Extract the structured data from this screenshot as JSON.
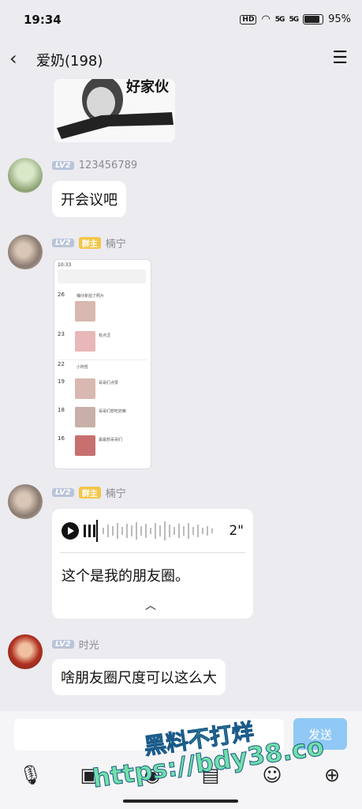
{
  "status": {
    "time": "19:34",
    "hd": "HD",
    "sig1": "5G",
    "sig2": "5G",
    "battery": "95%"
  },
  "header": {
    "title": "爱奶(198)"
  },
  "messages": [
    {
      "level": "LV2",
      "name": "123456789",
      "text": "开会议吧"
    },
    {
      "level": "LV2",
      "role": "群主",
      "name": "楠宁"
    },
    {
      "level": "LV2",
      "role": "群主",
      "name": "楠宁",
      "voice_duration": "2\"",
      "transcript": "这个是我的朋友圈。"
    },
    {
      "level": "LV2",
      "name": "时光",
      "text": "啥朋友圈尺度可以这么大"
    }
  ],
  "sticker": {
    "text": "好家伙"
  },
  "screenshot": {
    "top_time": "10:33",
    "entries": [
      {
        "day": "26",
        "text": "桶仔新拍了照片"
      },
      {
        "day": "23",
        "text": "有点涩"
      },
      {
        "day": "22",
        "text": "小阿哲"
      },
      {
        "day": "19",
        "text": "哥哥们点赞"
      },
      {
        "day": "18",
        "text": "哥哥们想吃奶嘛"
      },
      {
        "day": "16",
        "text": "最最想哥哥们"
      }
    ]
  },
  "composer": {
    "send_label": "发送"
  },
  "watermark": {
    "line1": "黑料不打烊",
    "line2": "https://bdy38.co"
  }
}
